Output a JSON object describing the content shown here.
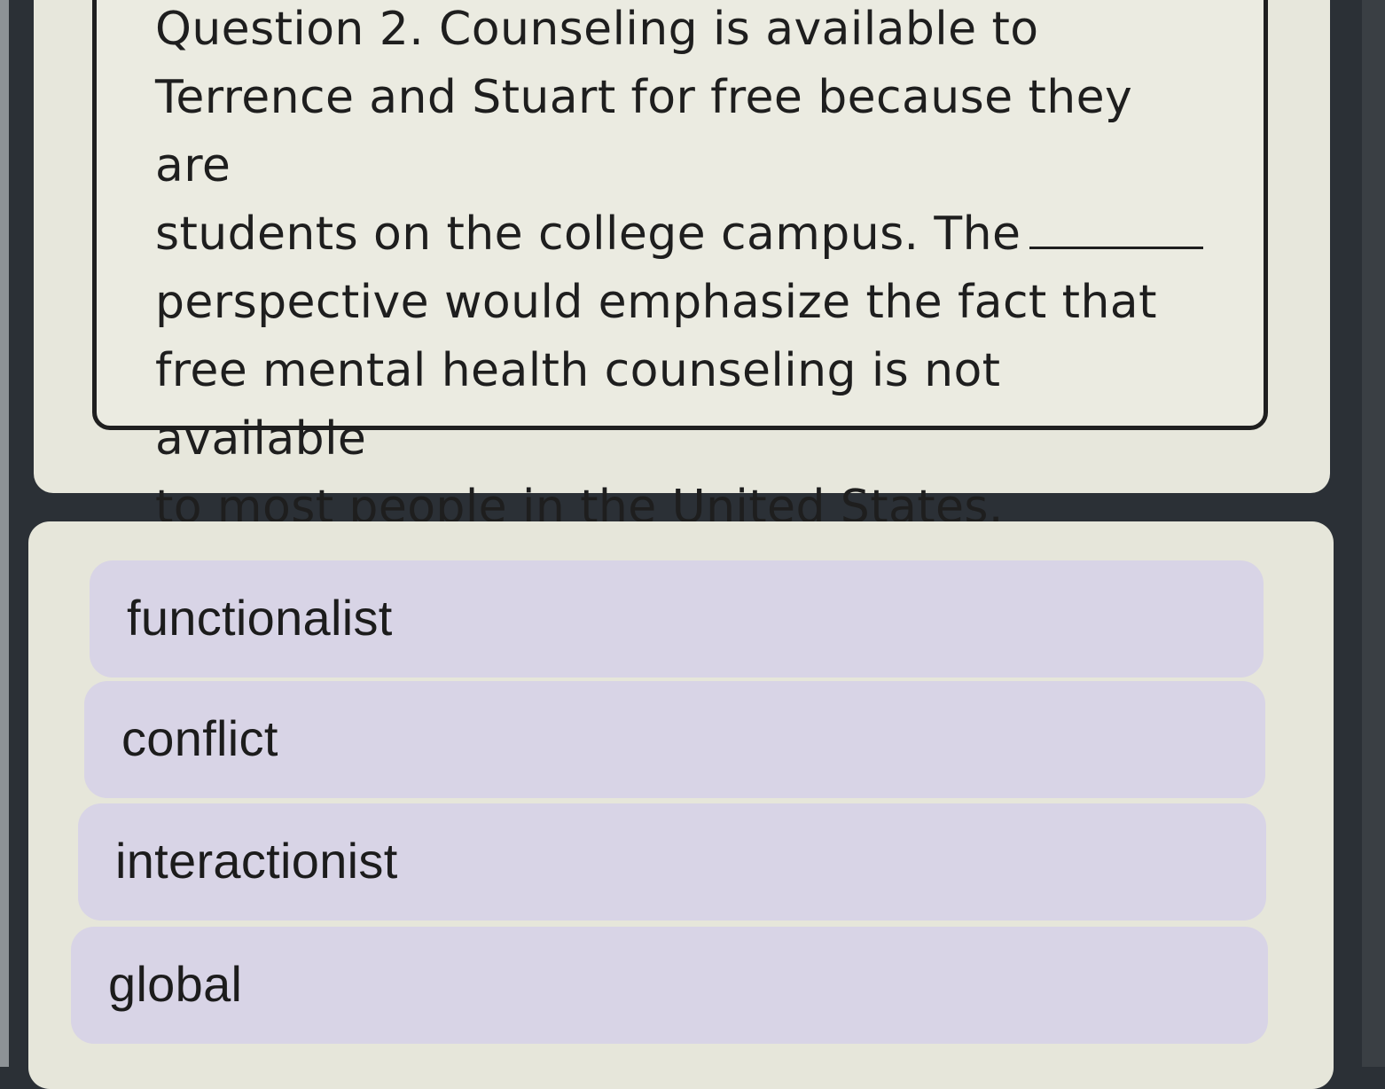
{
  "question": {
    "line1": "Question 2. Counseling is available to",
    "line2": "Terrence and Stuart for free because they are",
    "line3": "students on the college campus.  The",
    "line4": "perspective would emphasize the fact that",
    "line5": "free mental health counseling is not available",
    "line6": "to most people in the United States."
  },
  "options": [
    {
      "label": "functionalist"
    },
    {
      "label": "conflict"
    },
    {
      "label": "interactionist"
    },
    {
      "label": "global"
    }
  ],
  "colors": {
    "frame": "#2b3036",
    "card": "#e7e7dc",
    "option_bg": "#d8d4e6",
    "text": "#1e1e1e"
  }
}
